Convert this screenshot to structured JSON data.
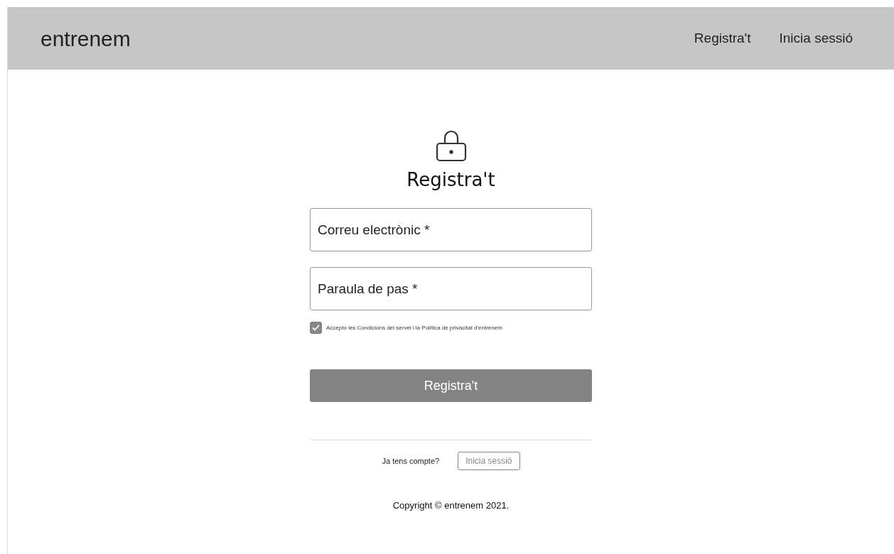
{
  "header": {
    "logo": "entrenem",
    "nav": [
      {
        "label": "Registra't"
      },
      {
        "label": "Inicia sessió"
      }
    ]
  },
  "form": {
    "title": "Registra't",
    "fields": [
      {
        "placeholder": "Correu electrònic *"
      },
      {
        "placeholder": "Paraula de pas *"
      }
    ],
    "terms": {
      "label": "Accepto les Condicions del servei i la Política de privacitat d'entrenem",
      "checked": true
    },
    "submit": "Registra't",
    "login_prompt": "Ja tens compte?",
    "login_button": "Inicia sessió"
  },
  "footer": "Copyright © entrenem 2021."
}
